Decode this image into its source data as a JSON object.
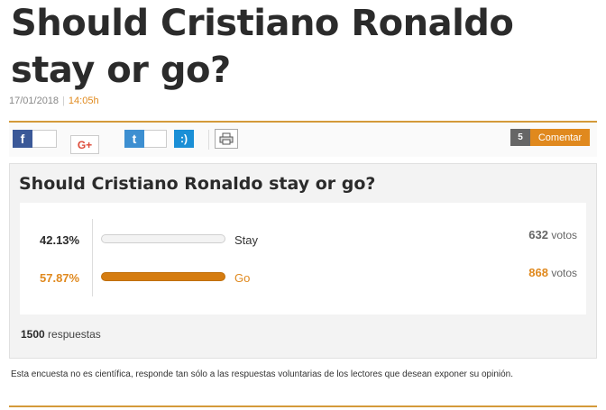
{
  "article": {
    "title": "Should Cristiano Ronaldo stay or go?",
    "date": "17/01/2018",
    "time": "14:05h"
  },
  "social": {
    "facebook_glyph": "f",
    "googleplus_glyph": "G+",
    "twitter_glyph": "t",
    "tuenti_glyph": ":)",
    "comment_count": "5",
    "comment_label": "Comentar"
  },
  "poll": {
    "question": "Should Cristiano Ronaldo stay or go?",
    "options": [
      {
        "label": "Stay",
        "percent": "42.13%",
        "fraction": 0.4213,
        "votes": "632",
        "votes_unit": "votos",
        "color": "#f3f3f3"
      },
      {
        "label": "Go",
        "percent": "57.87%",
        "fraction": 0.5787,
        "votes": "868",
        "votes_unit": "votos",
        "color": "#d57c10"
      }
    ],
    "total": "1500",
    "total_label": "respuestas",
    "accent_color": "#e0891e"
  },
  "disclaimer": "Esta encuesta no es científica, responde tan sólo a las respuestas voluntarias de los lectores que desean exponer su opinión."
}
